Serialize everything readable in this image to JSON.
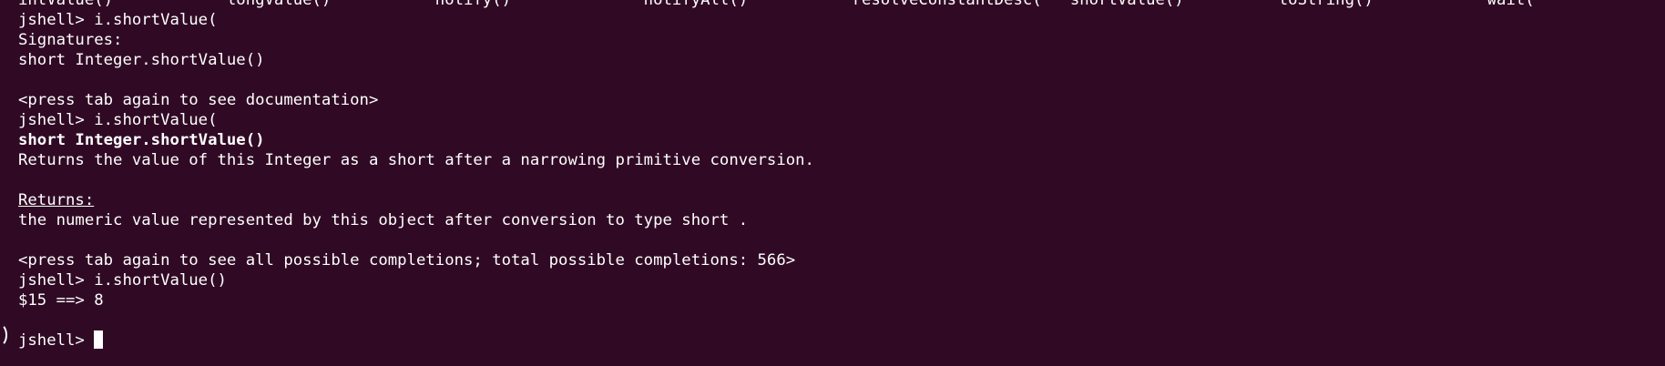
{
  "terminal": {
    "background": "#300a24",
    "foreground": "#ffffff",
    "cut_top_line": "intValue()            longValue()           notify()              notifyAll()           resolveConstantDesc(   shortValue()          toString()            wait(",
    "lines": [
      {
        "text": "jshell> i.shortValue(",
        "style": "normal"
      },
      {
        "text": "Signatures:",
        "style": "normal"
      },
      {
        "text": "short Integer.shortValue()",
        "style": "normal"
      },
      {
        "text": "",
        "style": "normal"
      },
      {
        "text": "<press tab again to see documentation>",
        "style": "normal"
      },
      {
        "text": "jshell> i.shortValue(",
        "style": "normal"
      },
      {
        "text": "short Integer.shortValue()",
        "style": "bold"
      },
      {
        "text": "Returns the value of this Integer as a short after a narrowing primitive conversion.",
        "style": "normal"
      },
      {
        "text": "",
        "style": "normal"
      },
      {
        "text": "Returns:",
        "style": "underline"
      },
      {
        "text": "the numeric value represented by this object after conversion to type short .",
        "style": "normal"
      },
      {
        "text": "",
        "style": "normal"
      },
      {
        "text": "<press tab again to see all possible completions; total possible completions: 566>",
        "style": "normal"
      },
      {
        "text": "jshell> i.shortValue()",
        "style": "normal"
      },
      {
        "text": "$15 ==> 8",
        "style": "normal"
      },
      {
        "text": "",
        "style": "normal"
      }
    ],
    "prompt": "jshell> "
  }
}
